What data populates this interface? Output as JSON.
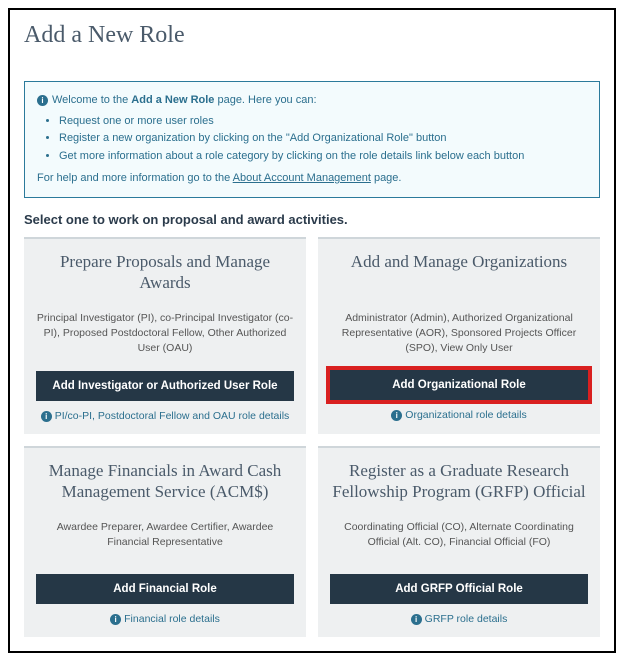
{
  "header": {
    "title": "Add a New Role",
    "subtitle": " "
  },
  "info_box": {
    "intro_prefix": "Welcome to the ",
    "intro_bold": "Add a New Role",
    "intro_suffix": " page. Here you can:",
    "bullets": [
      "Request one or more user roles",
      "Register a new organization by clicking on the \"Add Organizational Role\" button",
      "Get more information about a role category by clicking on the role details link below each button"
    ],
    "help_prefix": "For help and more information go to the ",
    "help_link": "About Account Management",
    "help_suffix": " page."
  },
  "select_heading": "Select one to work on proposal and award activities.",
  "cards": [
    {
      "title": "Prepare Proposals and Manage Awards",
      "desc": "Principal Investigator (PI), co-Principal Investigator (co-PI), Proposed Postdoctoral Fellow, Other Authorized User (OAU)",
      "button": "Add Investigator or Authorized User Role",
      "link": "PI/co-PI, Postdoctoral Fellow and OAU role details",
      "highlight": false
    },
    {
      "title": "Add and Manage Organizations",
      "desc": "Administrator (Admin), Authorized Organizational Representative (AOR), Sponsored Projects Officer (SPO), View Only User",
      "button": "Add Organizational Role",
      "link": "Organizational role details",
      "highlight": true
    },
    {
      "title": "Manage Financials in Award Cash Management Service (ACM$)",
      "desc": "Awardee Preparer, Awardee Certifier, Awardee Financial Representative",
      "button": "Add Financial Role",
      "link": "Financial role details",
      "highlight": false
    },
    {
      "title": "Register as a Graduate Research Fellowship Program (GRFP) Official",
      "desc": "Coordinating Official (CO), Alternate Coordinating Official (Alt. CO), Financial Official (FO)",
      "button": "Add GRFP Official Role",
      "link": "GRFP role details",
      "highlight": false
    }
  ]
}
